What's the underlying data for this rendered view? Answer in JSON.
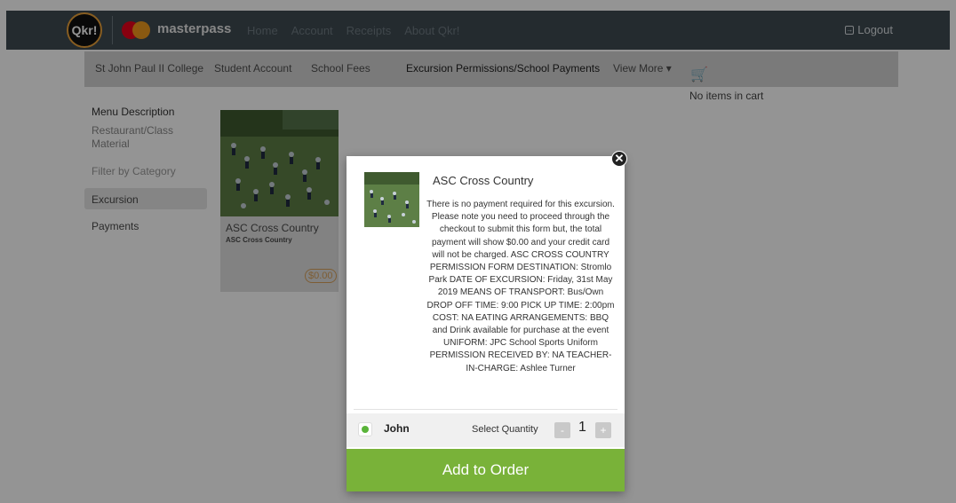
{
  "topbar": {
    "logo_text": "Qkr!",
    "brand": "masterpass",
    "nav": [
      "Home",
      "Account",
      "Receipts",
      "About Qkr!"
    ],
    "logout_label": "Logout",
    "colors": {
      "bar": "#3e4a52",
      "mastercard_red": "#eb001b",
      "mastercard_orange": "#f79e1b"
    }
  },
  "subnav": {
    "items": [
      "St John Paul II College",
      "Student Account",
      "School Fees",
      "Excursion Permissions/School Payments",
      "View More ▾"
    ]
  },
  "cart": {
    "icon": "cart-icon",
    "empty_text": "No items in cart"
  },
  "sidebar": {
    "heading": "Menu Description",
    "description": [
      "Restaurant/Class",
      "Material"
    ],
    "filter_label": "Filter by Category",
    "categories": [
      "Excursion",
      "Payments"
    ]
  },
  "product_card": {
    "title": "ASC Cross Country",
    "subtitle": "ASC Cross Country",
    "price": "$0.00"
  },
  "modal": {
    "title": "ASC Cross Country",
    "description": "There is no payment required for this excursion. Please note you need to proceed through the checkout to submit this form but, the total payment will show $0.00 and your credit card will not be charged. ASC CROSS COUNTRY PERMISSION FORM DESTINATION: Stromlo Park DATE OF EXCURSION: Friday, 31st May 2019 MEANS OF TRANSPORT: Bus/Own DROP OFF TIME: 9:00 PICK UP TIME: 2:00pm COST: NA EATING ARRANGEMENTS: BBQ and Drink available for purchase at the event UNIFORM: JPC School Sports Uniform PERMISSION RECEIVED BY: NA TEACHER-IN-CHARGE: Ashlee Turner",
    "student_name": "John",
    "select_quantity_label": "Select Quantity",
    "quantity": "1",
    "minus": "-",
    "plus": "+",
    "add_button": "Add to Order",
    "colors": {
      "add_button": "#79b239",
      "status_dot": "#5ab43a"
    }
  }
}
